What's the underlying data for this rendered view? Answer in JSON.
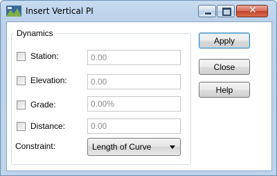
{
  "window": {
    "title": "Insert Vertical PI",
    "caption_buttons": {
      "minimize": "minimize-icon",
      "maximize": "maximize-icon",
      "close": "close-icon"
    }
  },
  "dynamics": {
    "group_label": "Dynamics",
    "rows": [
      {
        "label": "Station:",
        "value": "0.00",
        "checked": false
      },
      {
        "label": "Elevation:",
        "value": "0.00",
        "checked": false
      },
      {
        "label": "Grade:",
        "value": "0.00%",
        "checked": false
      },
      {
        "label": "Distance:",
        "value": "0.00",
        "checked": false
      }
    ],
    "constraint": {
      "label": "Constraint:",
      "selected": "Length of Curve"
    }
  },
  "buttons": {
    "apply": "Apply",
    "close": "Close",
    "help": "Help"
  },
  "colors": {
    "title_bar": "#c7dbf0",
    "close_button": "#c2412a",
    "disabled_text": "#8a8a8a"
  }
}
